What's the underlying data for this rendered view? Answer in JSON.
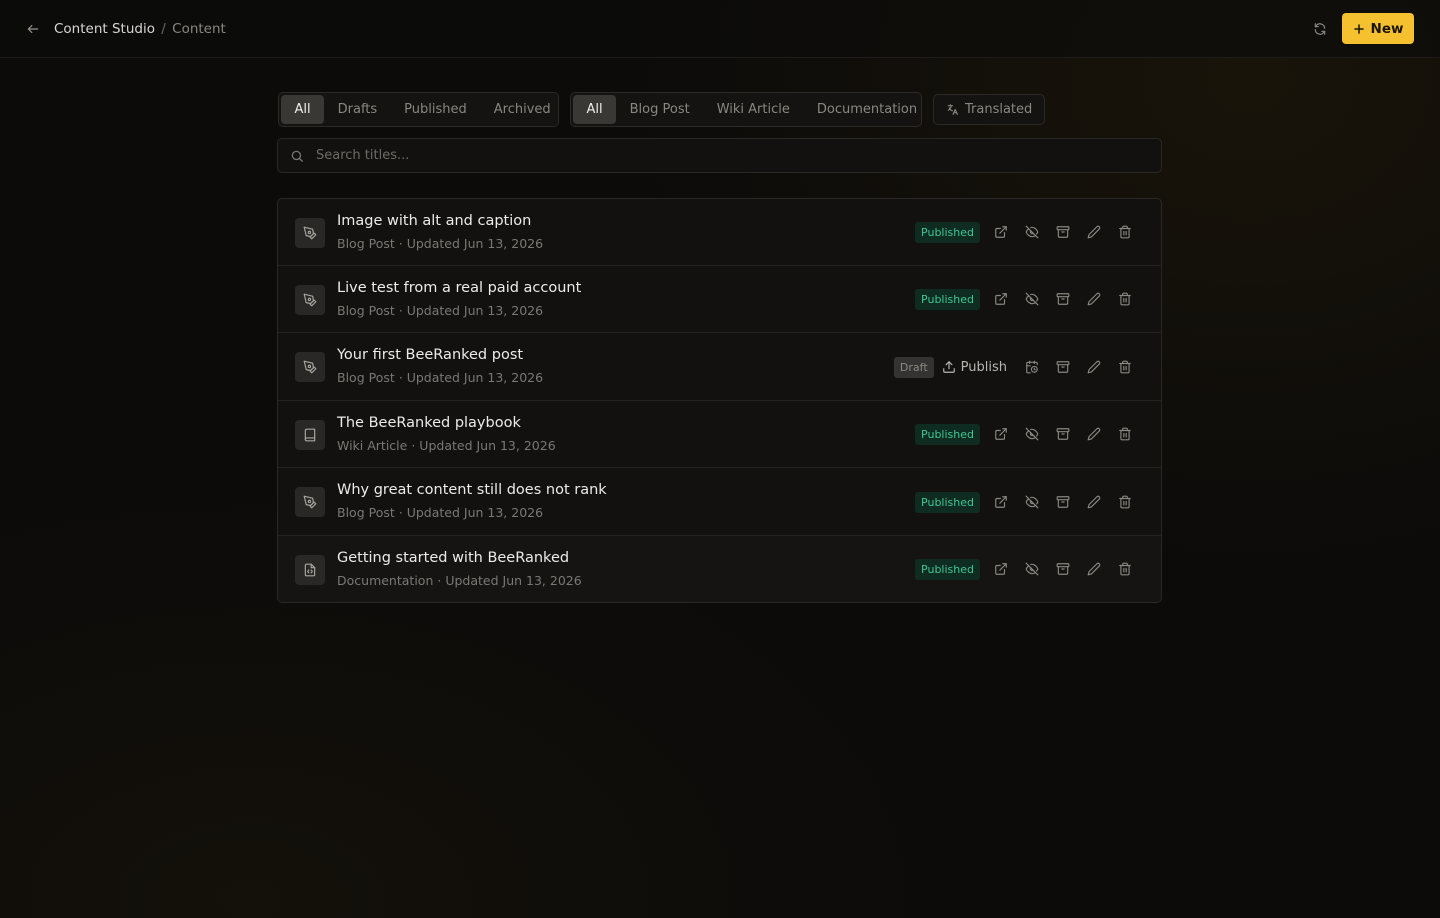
{
  "header": {
    "breadcrumb_root": "Content Studio",
    "breadcrumb_separator": "/",
    "breadcrumb_current": "Content",
    "new_button_label": "New"
  },
  "status_filter": {
    "items": [
      "All",
      "Drafts",
      "Published",
      "Archived"
    ],
    "selected": "All"
  },
  "type_filter": {
    "items": [
      "All",
      "Blog Post",
      "Wiki Article",
      "Documentation"
    ],
    "selected": "All"
  },
  "translated_toggle_label": "Translated",
  "search": {
    "placeholder": "Search titles...",
    "value": ""
  },
  "content_items": [
    {
      "title": "Image with alt and caption",
      "type": "Blog Post",
      "updated": "Updated Jun 13, 2026",
      "status": "Published",
      "icon": "pen-nib-icon"
    },
    {
      "title": "Live test from a real paid account",
      "type": "Blog Post",
      "updated": "Updated Jun 13, 2026",
      "status": "Published",
      "icon": "pen-nib-icon"
    },
    {
      "title": "Your first BeeRanked post",
      "type": "Blog Post",
      "updated": "Updated Jun 13, 2026",
      "status": "Draft",
      "publish_label": "Publish",
      "icon": "pen-nib-icon"
    },
    {
      "title": "The BeeRanked playbook",
      "type": "Wiki Article",
      "updated": "Updated Jun 13, 2026",
      "status": "Published",
      "icon": "book-icon"
    },
    {
      "title": "Why great content still does not rank",
      "type": "Blog Post",
      "updated": "Updated Jun 13, 2026",
      "status": "Published",
      "icon": "pen-nib-icon"
    },
    {
      "title": "Getting started with BeeRanked",
      "type": "Documentation",
      "updated": "Updated Jun 13, 2026",
      "status": "Published",
      "icon": "file-code-icon"
    }
  ],
  "meta_separator": "·",
  "colors": {
    "accent": "#f6c12e",
    "published_badge_bg": "#0f2c22",
    "published_badge_text": "#3fc795",
    "draft_badge_bg": "#353331"
  }
}
